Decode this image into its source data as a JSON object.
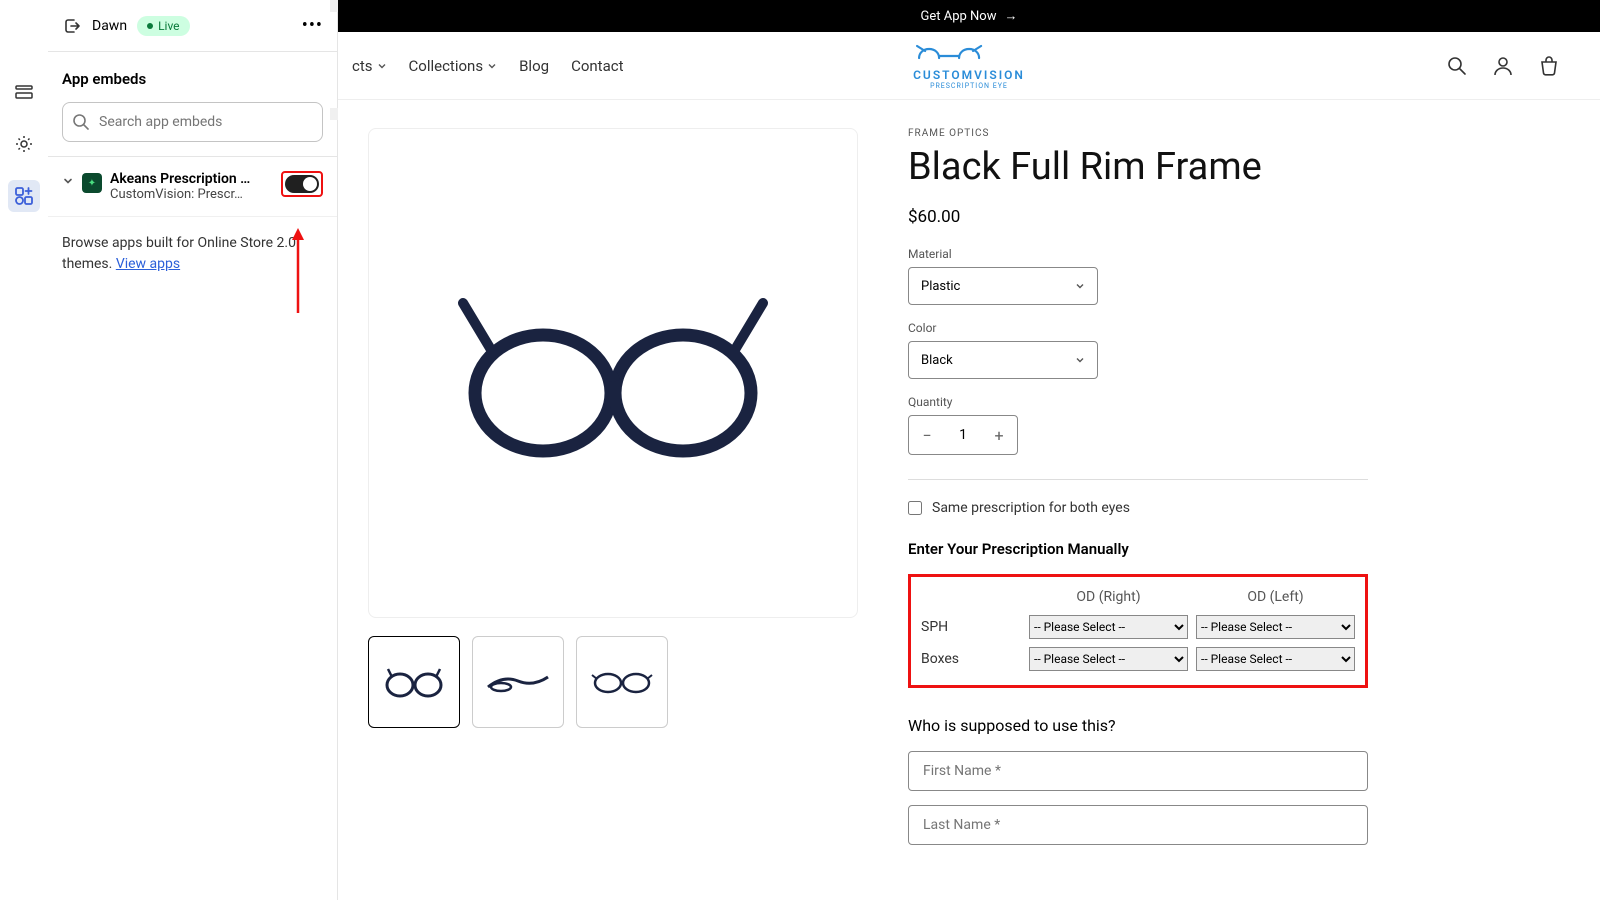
{
  "header": {
    "theme": "Dawn",
    "status": "Live"
  },
  "panel": {
    "title": "App embeds",
    "search_placeholder": "Search app embeds",
    "embed": {
      "name": "Akeans Prescription …",
      "sub": "CustomVision: Prescr…"
    },
    "browse_text": "Browse apps built for Online Store 2.0 themes. ",
    "view_apps": "View apps"
  },
  "preview": {
    "banner": "Get App Now",
    "logo_main": "CUSTOMVISION",
    "logo_sub": "PRESCRIPTION EYE",
    "nav": {
      "products": "cts",
      "collections": "Collections",
      "blog": "Blog",
      "contact": "Contact"
    },
    "product": {
      "vendor": "FRAME OPTICS",
      "title": "Black Full Rim Frame",
      "price": "$60.00",
      "material_label": "Material",
      "material_value": "Plastic",
      "color_label": "Color",
      "color_value": "Black",
      "qty_label": "Quantity",
      "qty_value": "1",
      "same_rx": "Same prescription for both eyes",
      "rx_title": "Enter Your Prescription Manually",
      "od_right": "OD (Right)",
      "od_left": "OD (Left)",
      "row1": "SPH",
      "row2": "Boxes",
      "select_placeholder": "-- Please Select --",
      "who_title": "Who is supposed to use this?",
      "first_name_ph": "First Name *",
      "last_name_ph": "Last Name *"
    }
  }
}
